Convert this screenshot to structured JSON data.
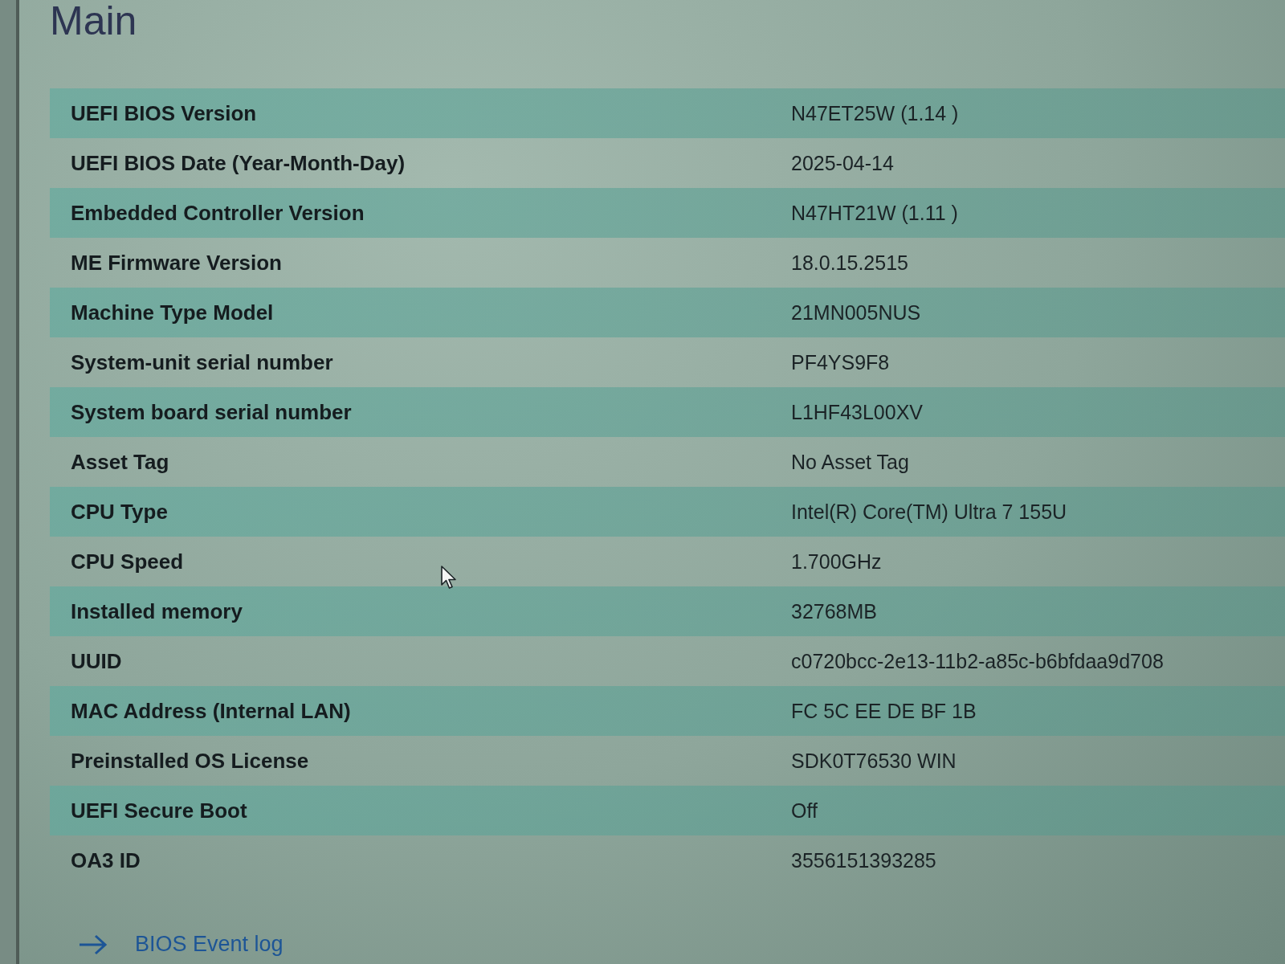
{
  "title": "Main",
  "rows": [
    {
      "label": "UEFI BIOS Version",
      "value": "N47ET25W (1.14 )"
    },
    {
      "label": "UEFI BIOS Date (Year-Month-Day)",
      "value": "2025-04-14"
    },
    {
      "label": "Embedded Controller Version",
      "value": "N47HT21W (1.11 )"
    },
    {
      "label": "ME Firmware Version",
      "value": "18.0.15.2515"
    },
    {
      "label": "Machine Type Model",
      "value": "21MN005NUS"
    },
    {
      "label": "System-unit serial number",
      "value": "PF4YS9F8"
    },
    {
      "label": "System board serial number",
      "value": "L1HF43L00XV"
    },
    {
      "label": "Asset Tag",
      "value": "No Asset Tag"
    },
    {
      "label": "CPU Type",
      "value": "Intel(R) Core(TM) Ultra 7 155U"
    },
    {
      "label": "CPU Speed",
      "value": "1.700GHz"
    },
    {
      "label": "Installed memory",
      "value": "32768MB"
    },
    {
      "label": "UUID",
      "value": "c0720bcc-2e13-11b2-a85c-b6bfdaa9d708"
    },
    {
      "label": "MAC Address (Internal LAN)",
      "value": "FC 5C EE DE BF 1B"
    },
    {
      "label": "Preinstalled OS License",
      "value": "SDK0T76530 WIN"
    },
    {
      "label": "UEFI Secure Boot",
      "value": "Off"
    },
    {
      "label": "OA3 ID",
      "value": "3556151393285"
    }
  ],
  "link": {
    "label": "BIOS Event log"
  }
}
